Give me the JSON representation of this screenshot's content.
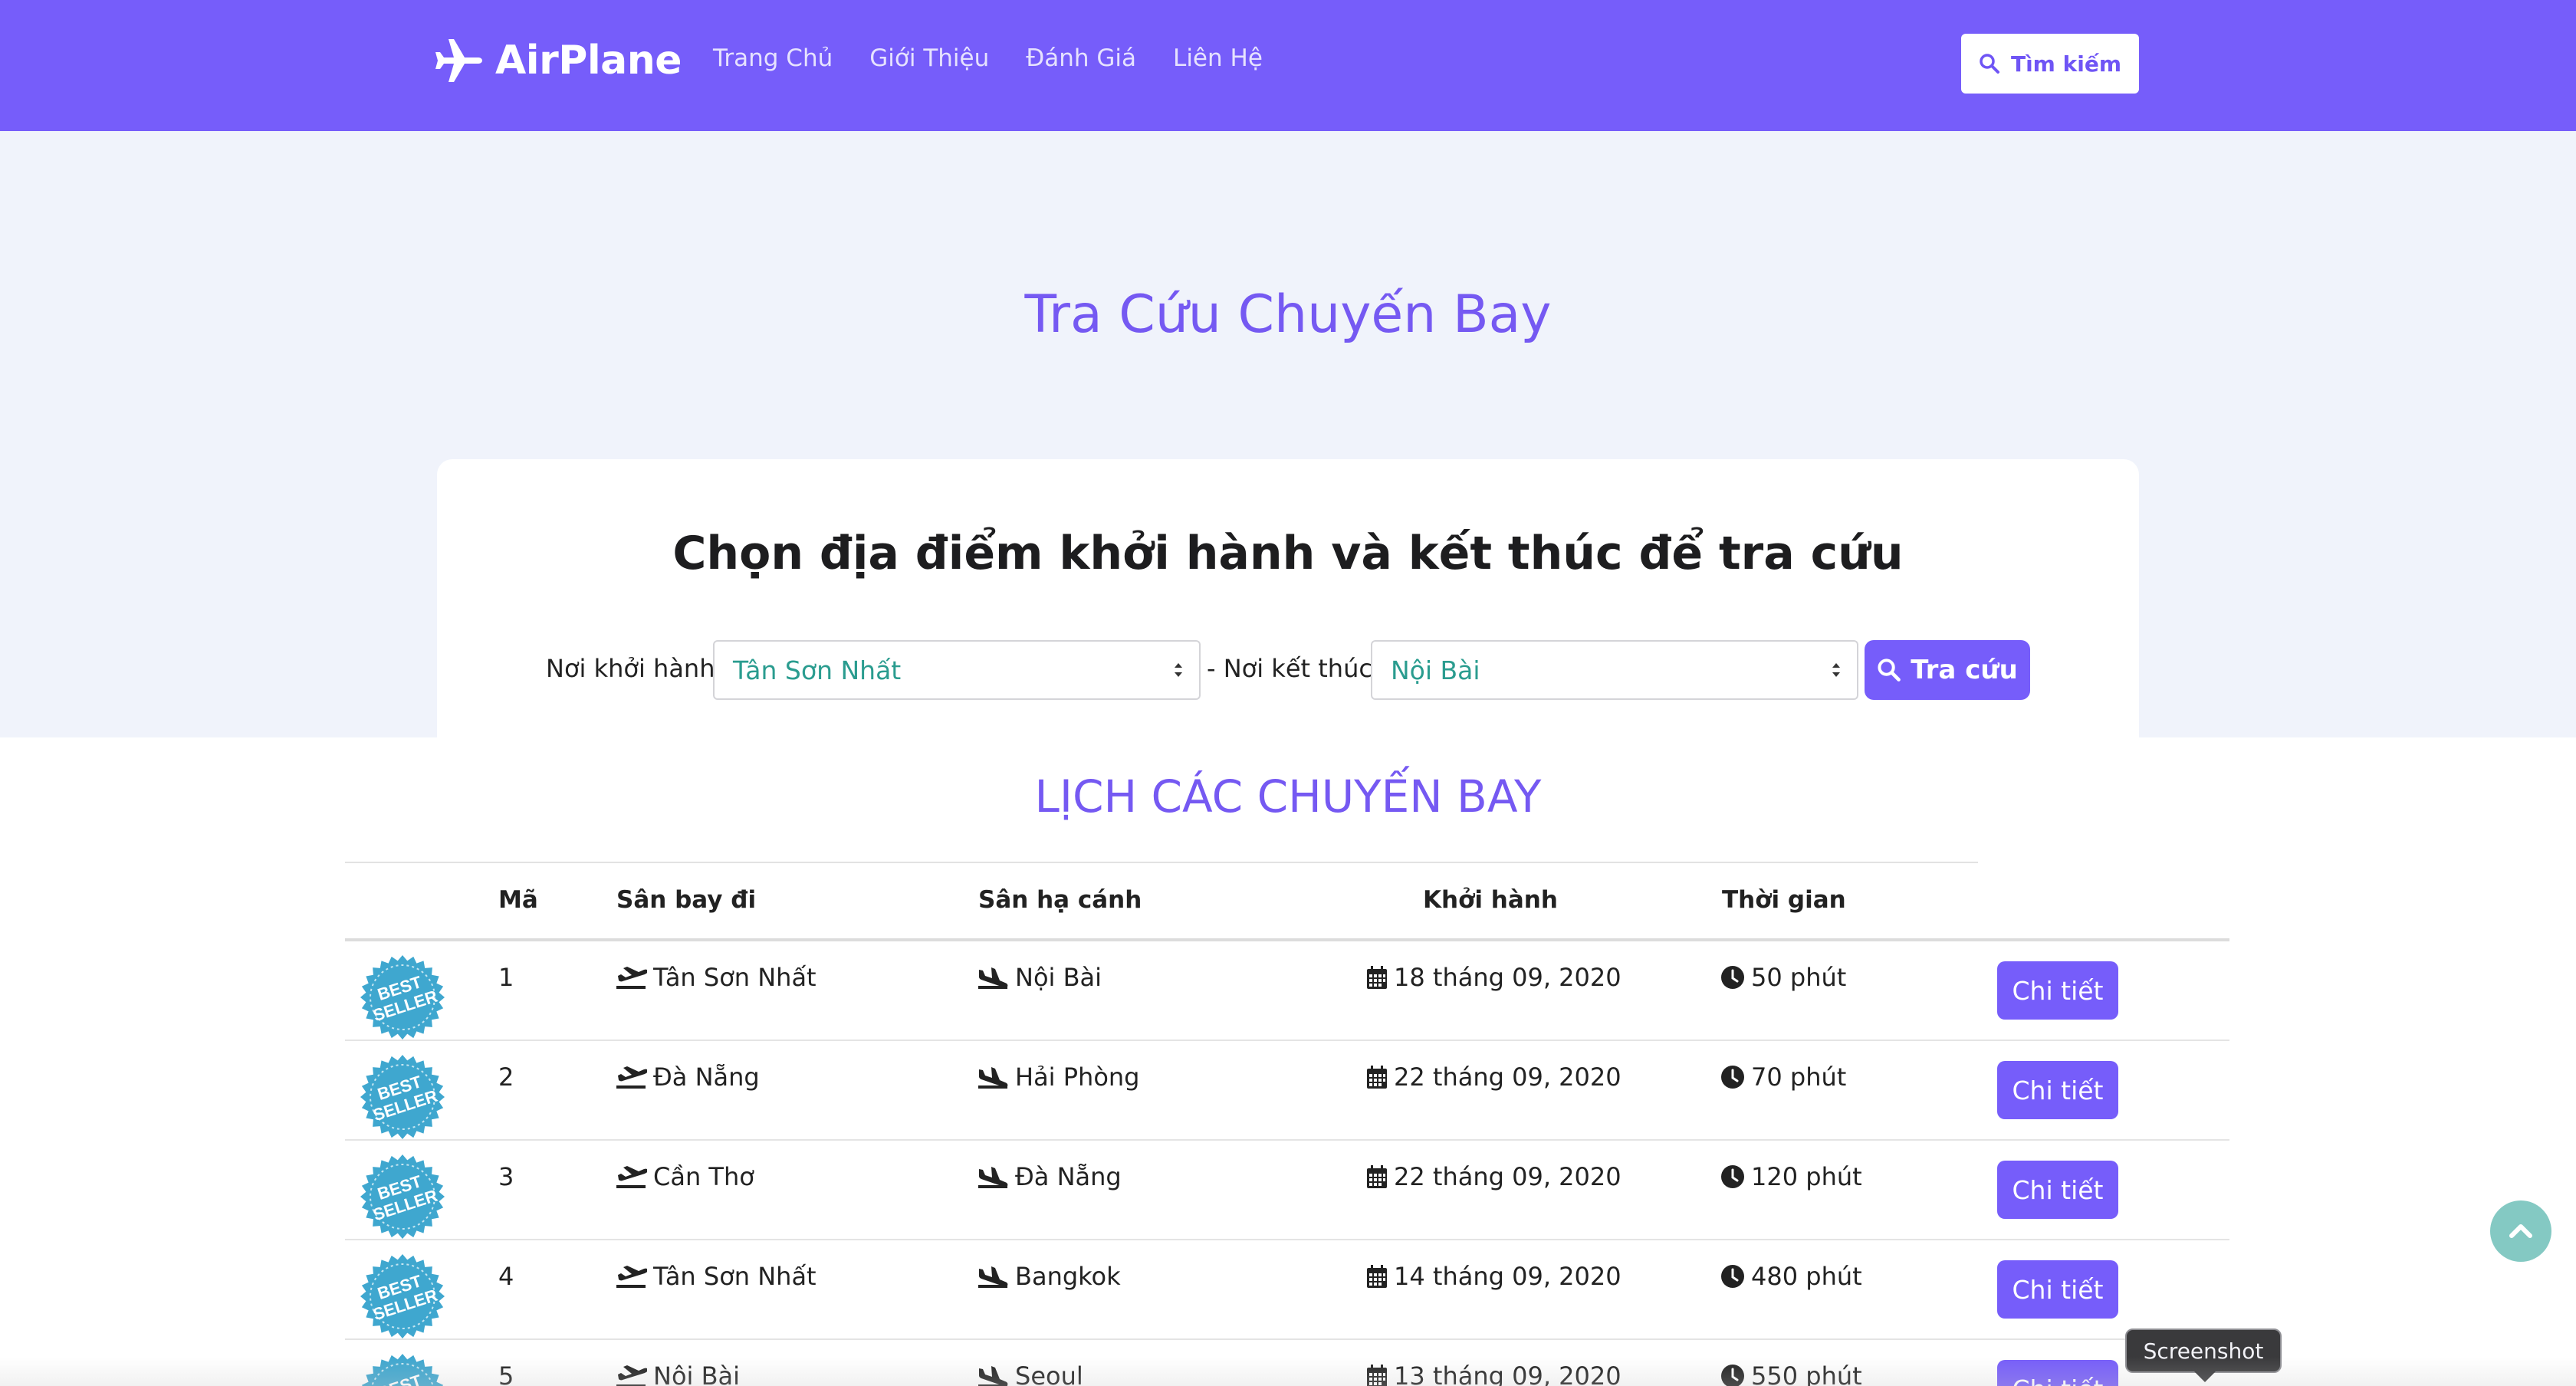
{
  "brand": {
    "name": "AirPlane",
    "icon": "airplane-icon"
  },
  "nav": {
    "links": [
      "Trang Chủ",
      "Giới Thiệu",
      "Đánh Giá",
      "Liên Hệ"
    ],
    "search_label": "Tìm kiếm"
  },
  "hero": {
    "title": "Tra Cứu Chuyến Bay",
    "card_heading": "Chọn địa điểm khởi hành và kết thúc để tra cứu",
    "from_label": "Nơi khởi hành:",
    "from_value": "Tân Sơn Nhất",
    "to_label": "- Nơi kết thúc:",
    "to_value": "Nội Bài",
    "lookup_label": "Tra cứu"
  },
  "schedule": {
    "title": "LỊCH CÁC CHUYẾN BAY",
    "columns": [
      "Mã",
      "Sân bay đi",
      "Sân hạ cánh",
      "Khởi hành",
      "Thời gian"
    ],
    "badge_text": [
      "BEST",
      "SELLER"
    ],
    "detail_label": "Chi tiết",
    "rows": [
      {
        "id": "1",
        "from": "Tân Sơn Nhất",
        "to": "Nội Bài",
        "date": "18 tháng 09, 2020",
        "duration": "50 phút"
      },
      {
        "id": "2",
        "from": "Đà Nẵng",
        "to": "Hải Phòng",
        "date": "22 tháng 09, 2020",
        "duration": "70 phút"
      },
      {
        "id": "3",
        "from": "Cần Thơ",
        "to": "Đà Nẵng",
        "date": "22 tháng 09, 2020",
        "duration": "120 phút"
      },
      {
        "id": "4",
        "from": "Tân Sơn Nhất",
        "to": "Bangkok",
        "date": "14 tháng 09, 2020",
        "duration": "480 phút"
      },
      {
        "id": "5",
        "from": "Nội Bài",
        "to": "Seoul",
        "date": "13 tháng 09, 2020",
        "duration": "550 phút"
      }
    ]
  },
  "tooltip": {
    "text": "Screenshot"
  },
  "colors": {
    "primary": "#765dfa",
    "hero_bg": "#f0f3fb",
    "badge": "#3fa7cf",
    "scroll_top": "#84c9c3",
    "select_text": "#2a9c8f"
  }
}
